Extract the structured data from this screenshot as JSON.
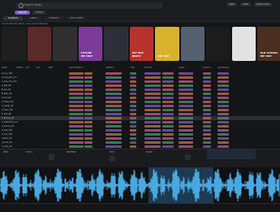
{
  "search": {
    "placeholder": "Search views"
  },
  "filter_pills": [
    {
      "label": "LIBRARY",
      "active": true
    },
    {
      "label": "FILTER",
      "active": false
    }
  ],
  "top_right": {
    "btn1": "USER",
    "btn2": "LOOP",
    "count": "1580 results"
  },
  "tabs": [
    {
      "label": "SOURCES",
      "active": true
    },
    {
      "label": "LABELS",
      "active": false
    },
    {
      "label": "FORMATS",
      "active": false
    },
    {
      "label": "KEYS & BPM",
      "active": false
    }
  ],
  "breadcrumb": "Search Results  |  Back  |  Save Search Results",
  "covers": [
    {
      "label": "",
      "bg": "#1f1f1f"
    },
    {
      "label": "",
      "bg": "#5a2a2a"
    },
    {
      "label": "",
      "bg": "#303030"
    },
    {
      "label": "FUTURE\nHIP HOP",
      "bg": "#7d3a9a"
    },
    {
      "label": "",
      "bg": "#2f2f3a"
    },
    {
      "label": "HIP HOP\nBEATS",
      "bg": "#b8322d"
    },
    {
      "label": "HIP HOP",
      "bg": "#d8b12d"
    },
    {
      "label": "",
      "bg": "#556070"
    },
    {
      "label": "",
      "bg": "#1c1c1c"
    },
    {
      "label": "",
      "bg": "#e2e2e2"
    },
    {
      "label": "OLD SCHOOL\nHIP HOP",
      "bg": "#4a2e1f"
    }
  ],
  "table": {
    "headers": [
      "NAME",
      "TEMPO",
      "KEY",
      "LEN",
      "BPM",
      "INSTRUMENTS",
      "GENRES",
      "TYPE",
      "MOODS",
      "LABEL",
      "LENGTH",
      "ADDITIONAL"
    ],
    "rows": [
      {
        "name": "LA_LA_158",
        "sel": false
      },
      {
        "name": "A_Long_80_min",
        "sel": false
      },
      {
        "name": "A_Low_Cut_123",
        "sel": false
      },
      {
        "name": "A_Pad_80",
        "sel": false
      },
      {
        "name": "B_Arp_90",
        "sel": false
      },
      {
        "name": "B_Bass_92",
        "sel": false
      },
      {
        "name": "Chord_99",
        "sel": false
      },
      {
        "name": "C_Flute_102",
        "sel": false
      },
      {
        "name": "C_Guitar_92",
        "sel": false
      },
      {
        "name": "D_Piano_85",
        "sel": false
      },
      {
        "name": "E_Sub_88",
        "sel": false
      },
      {
        "name": "F_Strings_90",
        "sel": true
      },
      {
        "name": "G_Distorted_solo",
        "sel": false
      },
      {
        "name": "G_Drums_94",
        "sel": false
      },
      {
        "name": "H_Keys_96",
        "sel": false
      },
      {
        "name": "H_Vox_100",
        "sel": false
      },
      {
        "name": "I_Brass_84",
        "sel": false
      },
      {
        "name": "J_Synth_92",
        "sel": false
      },
      {
        "name": "K_Loop_90",
        "sel": false
      }
    ]
  },
  "transport": {
    "bpm_label": "BPM",
    "pitch_label": "PITCH",
    "pattern_label": "PATTERN",
    "sync_label": "SYNC",
    "edit_label": "EDIT",
    "mode_label": "MODE"
  },
  "colors": {
    "accent": "#7a5bd1",
    "wave": "#4aa8e0",
    "tag_purple": "#8a57c9",
    "tag_green": "#3aa35e",
    "tag_pink": "#c95a92",
    "tag_orange": "#c07a3a"
  }
}
